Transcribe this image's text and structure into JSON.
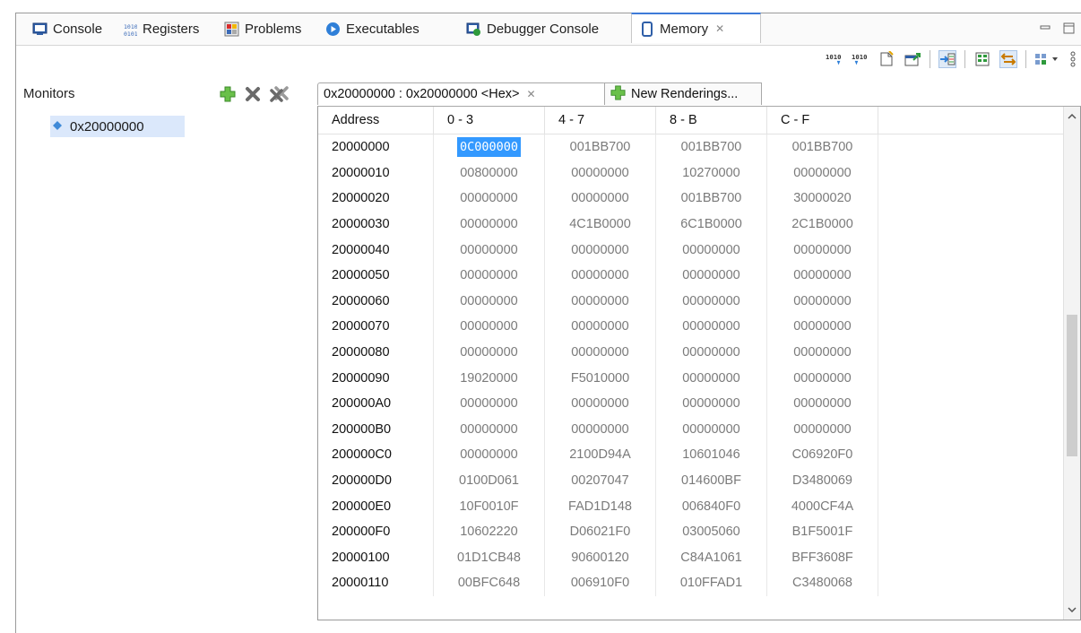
{
  "tabs": [
    {
      "label": "Console",
      "icon": "console-icon"
    },
    {
      "label": "Registers",
      "icon": "registers-icon"
    },
    {
      "label": "Problems",
      "icon": "problems-icon"
    },
    {
      "label": "Executables",
      "icon": "executables-icon"
    },
    {
      "label": "Debugger Console",
      "icon": "debugger-console-icon"
    },
    {
      "label": "Memory",
      "icon": "memory-icon",
      "active": true
    }
  ],
  "tab_close_glyph": "✕",
  "toolbar": {
    "import_label": "1010",
    "export_label": "1010"
  },
  "monitors": {
    "title": "Monitors",
    "items": [
      "0x20000000"
    ]
  },
  "renderings": {
    "active_tab": "0x20000000 : 0x20000000 <Hex>",
    "new_tab": "New Renderings..."
  },
  "memory_table": {
    "headers": [
      "Address",
      "0 - 3",
      "4 - 7",
      "8 - B",
      "C - F"
    ],
    "rows": [
      [
        "20000000",
        "0C000000",
        "001BB700",
        "001BB700",
        "001BB700"
      ],
      [
        "20000010",
        "00800000",
        "00000000",
        "10270000",
        "00000000"
      ],
      [
        "20000020",
        "00000000",
        "00000000",
        "001BB700",
        "30000020"
      ],
      [
        "20000030",
        "00000000",
        "4C1B0000",
        "6C1B0000",
        "2C1B0000"
      ],
      [
        "20000040",
        "00000000",
        "00000000",
        "00000000",
        "00000000"
      ],
      [
        "20000050",
        "00000000",
        "00000000",
        "00000000",
        "00000000"
      ],
      [
        "20000060",
        "00000000",
        "00000000",
        "00000000",
        "00000000"
      ],
      [
        "20000070",
        "00000000",
        "00000000",
        "00000000",
        "00000000"
      ],
      [
        "20000080",
        "00000000",
        "00000000",
        "00000000",
        "00000000"
      ],
      [
        "20000090",
        "19020000",
        "F5010000",
        "00000000",
        "00000000"
      ],
      [
        "200000A0",
        "00000000",
        "00000000",
        "00000000",
        "00000000"
      ],
      [
        "200000B0",
        "00000000",
        "00000000",
        "00000000",
        "00000000"
      ],
      [
        "200000C0",
        "00000000",
        "2100D94A",
        "10601046",
        "C06920F0"
      ],
      [
        "200000D0",
        "0100D061",
        "00207047",
        "014600BF",
        "D3480069"
      ],
      [
        "200000E0",
        "10F0010F",
        "FAD1D148",
        "006840F0",
        "4000CF4A"
      ],
      [
        "200000F0",
        "10602220",
        "D06021F0",
        "03005060",
        "B1F5001F"
      ],
      [
        "20000100",
        "01D1CB48",
        "90600120",
        "C84A1061",
        "BFF3608F"
      ],
      [
        "20000110",
        "00BFC648",
        "006910F0",
        "010FFAD1",
        "C3480068"
      ]
    ],
    "selected_cell": {
      "row": 0,
      "col": 1
    }
  },
  "colors": {
    "selection": "#3399ff",
    "monitor_selection": "#dbe8fb",
    "active_tab_accent": "#3d7ad8"
  }
}
